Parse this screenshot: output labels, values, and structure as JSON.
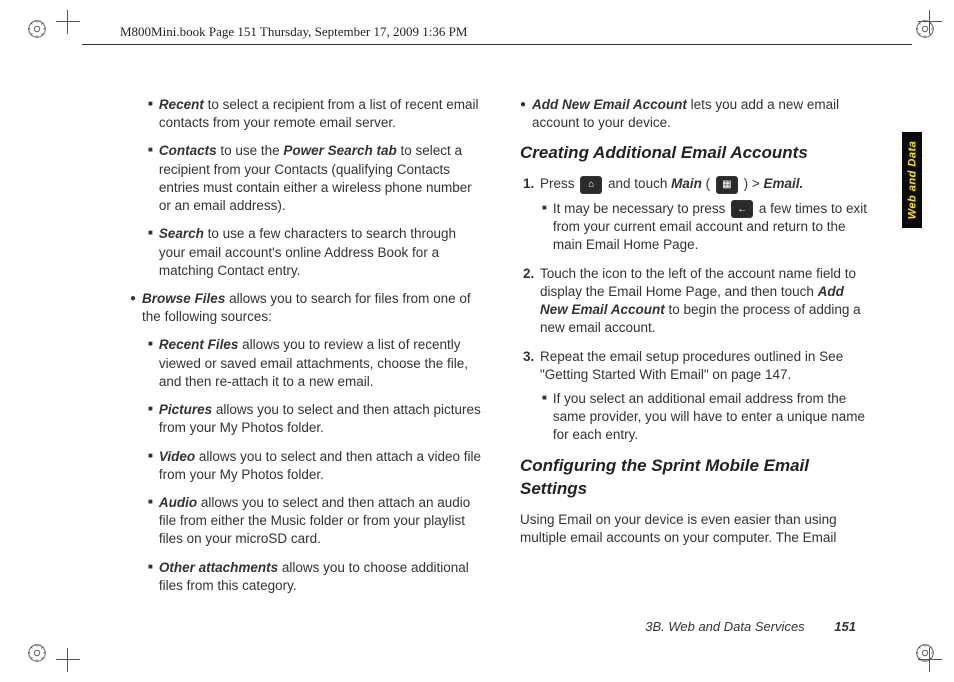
{
  "header": {
    "crop_text": "M800Mini.book  Page 151  Thursday, September 17, 2009  1:36 PM"
  },
  "sidetab": {
    "label": "Web and Data"
  },
  "left": {
    "recent": {
      "term": "Recent",
      "body": " to select a recipient from a list of recent email contacts from your remote email server."
    },
    "contacts": {
      "term": "Contacts",
      "body1": " to use the ",
      "pst": "Power Search tab",
      "body2": " to select a recipient from your Contacts (qualifying Contacts entries must contain either a wireless phone number or an email address)."
    },
    "search": {
      "term": "Search",
      "body": " to use a few characters to search through your email account's online Address Book for a matching Contact entry."
    },
    "browse": {
      "term": "Browse Files",
      "body": " allows you to search for files from one of the following sources:"
    },
    "recentfiles": {
      "term": "Recent Files",
      "body": " allows you to review a list of recently viewed or saved email attachments, choose the file, and then re-attach it to a new email."
    },
    "pictures": {
      "term": "Pictures",
      "body": " allows you to select and then attach pictures from your My Photos folder."
    },
    "video": {
      "term": "Video",
      "body": " allows you to select and then attach a video file from your My Photos folder."
    },
    "audio": {
      "term": "Audio",
      "body": " allows you to select and then attach an audio file from either the Music folder or from your playlist files on your microSD card."
    },
    "other": {
      "term": "Other attachments",
      "body": " allows you to choose additional files from this category."
    }
  },
  "right": {
    "addnew": {
      "term": "Add New Email Account",
      "body": " lets you add a new email account to your device."
    },
    "h1": "Creating Additional Email Accounts",
    "step1": {
      "press": "Press ",
      "andtouch": " and touch ",
      "main": "Main",
      "paren_open": " ( ",
      "paren_close": " ) > ",
      "email": "Email."
    },
    "step1sub": {
      "a": "It may be necessary to press ",
      "b": " a few times to exit from your current email account and return to the main Email Home Page."
    },
    "step2": {
      "a": "Touch the icon to the left of the account name field to display the Email Home Page, and then touch ",
      "term": "Add New Email Account",
      "b": " to begin the process of adding a new email account."
    },
    "step3": "Repeat the email setup procedures outlined in See \"Getting Started With Email\" on page 147.",
    "step3sub": "If you select an additional email address from the same provider, you will have to enter a unique name for each entry.",
    "h2": "Configuring the Sprint Mobile Email Settings",
    "p1": "Using Email on your device is even easier than using multiple email accounts on your computer. The Email"
  },
  "footer": {
    "section": "3B. Web and Data Services",
    "page": "151"
  }
}
